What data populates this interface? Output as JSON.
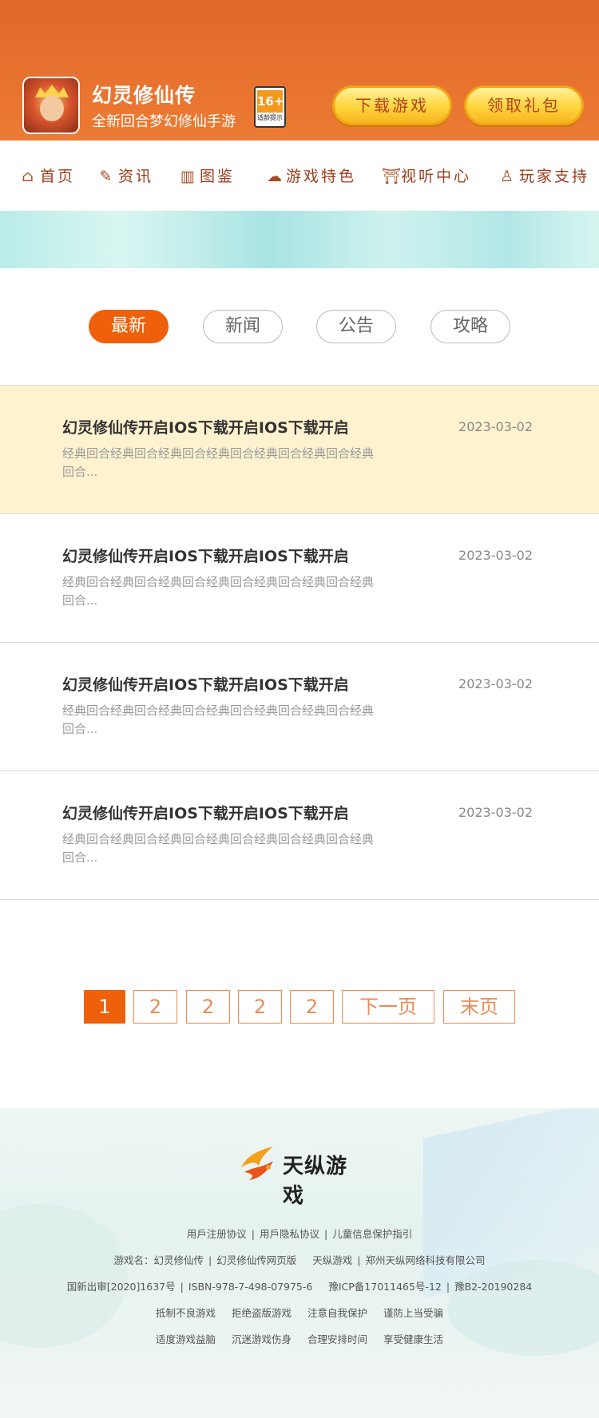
{
  "header": {
    "app_title": "幻灵修仙传",
    "app_subtitle": "全新回合梦幻修仙手游",
    "age_rating": "16+",
    "age_rating_note": "适龄提示",
    "download_button": "下载游戏",
    "gift_button": "领取礼包",
    "colors": {
      "header_bg": "#e2672b",
      "button_yellow": "#ffd43c"
    }
  },
  "nav": {
    "items": [
      {
        "label": "首页",
        "icon": "home-icon"
      },
      {
        "label": "资讯",
        "icon": "scroll-icon"
      },
      {
        "label": "图鉴",
        "icon": "book-icon"
      },
      {
        "label": "游戏特色",
        "icon": "cloud-icon"
      },
      {
        "label": "视听中心",
        "icon": "gate-icon"
      },
      {
        "label": "玩家支持",
        "icon": "person-icon"
      }
    ]
  },
  "tabs": [
    {
      "label": "最新",
      "active": true
    },
    {
      "label": "新闻",
      "active": false
    },
    {
      "label": "公告",
      "active": false
    },
    {
      "label": "攻略",
      "active": false
    }
  ],
  "articles": [
    {
      "title": "幻灵修仙传开启IOS下载开启IOS下载开启",
      "date": "2023-03-02",
      "desc": "经典回合经典回合经典回合经典回合经典回合经典回合经典回合...",
      "highlighted": true
    },
    {
      "title": "幻灵修仙传开启IOS下载开启IOS下载开启",
      "date": "2023-03-02",
      "desc": "经典回合经典回合经典回合经典回合经典回合经典回合经典回合...",
      "highlighted": false
    },
    {
      "title": "幻灵修仙传开启IOS下载开启IOS下载开启",
      "date": "2023-03-02",
      "desc": "经典回合经典回合经典回合经典回合经典回合经典回合经典回合...",
      "highlighted": false
    },
    {
      "title": "幻灵修仙传开启IOS下载开启IOS下载开启",
      "date": "2023-03-02",
      "desc": "经典回合经典回合经典回合经典回合经典回合经典回合经典回合...",
      "highlighted": false
    }
  ],
  "pagination": {
    "pages": [
      "1",
      "2",
      "2",
      "2",
      "2"
    ],
    "current": "1",
    "next_label": "下一页",
    "last_label": "末页"
  },
  "footer": {
    "brand": "天纵游戏",
    "line1": [
      "用戶注册协议",
      "用戶隐私协议",
      "儿童信息保护指引"
    ],
    "line2": [
      "游戏名：幻灵修仙传",
      "幻灵修仙传网页版",
      "天纵游戏",
      "郑州天纵网络科技有限公司"
    ],
    "line3": [
      "国新出审[2020]1637号",
      "ISBN-978-7-498-07975-6",
      "豫ICP备17011465号-12",
      "豫B2-20190284"
    ],
    "line4": [
      "抵制不良游戏",
      "拒绝盗版游戏",
      "注意自我保护",
      "谨防上当受骗"
    ],
    "line5": [
      "适度游戏益脑",
      "沉迷游戏伤身",
      "合理安排时间",
      "享受健康生活"
    ]
  }
}
